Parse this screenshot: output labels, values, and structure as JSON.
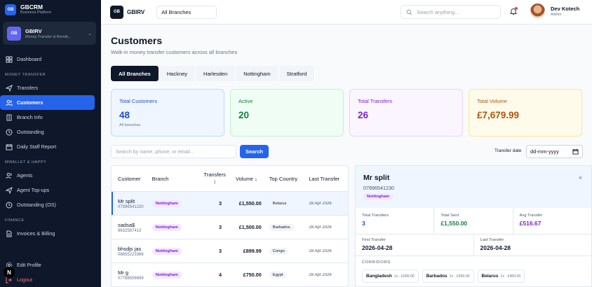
{
  "brand": {
    "logo": "GB",
    "title": "GBCRM",
    "subtitle": "Business Platform"
  },
  "branch_switch": {
    "logo": "GB",
    "name": "GBIRV",
    "description": "Money Transfer & Remitt..."
  },
  "sidebar": {
    "top": [
      {
        "label": "Dashboard",
        "icon": "dashboard-icon"
      }
    ],
    "sections": [
      {
        "title": "MONEY TRANSFER",
        "items": [
          {
            "label": "Transfers",
            "icon": "send-icon"
          },
          {
            "label": "Customers",
            "icon": "users-icon",
            "active": true
          },
          {
            "label": "Branch Info",
            "icon": "building-icon"
          },
          {
            "label": "Outstanding",
            "icon": "clock-icon"
          },
          {
            "label": "Daily Staff Report",
            "icon": "calendar-icon"
          }
        ]
      },
      {
        "title": "MWALLET & HAPPY",
        "items": [
          {
            "label": "Agents",
            "icon": "users-icon"
          },
          {
            "label": "Agent Top-ups",
            "icon": "send-icon"
          },
          {
            "label": "Outstanding (OS)",
            "icon": "clock-icon"
          }
        ]
      },
      {
        "title": "FINANCE",
        "items": [
          {
            "label": "Invoices & Billing",
            "icon": "invoice-icon"
          }
        ]
      }
    ],
    "footer": {
      "edit_profile": "Edit Profile",
      "logout": "Logout"
    },
    "floating_badge": "N"
  },
  "topbar": {
    "logo": "GB",
    "name": "GBIRV",
    "branch_select": "All Branches",
    "search_placeholder": "Search anything...",
    "user": {
      "name": "Dev Kotech",
      "role": "Admin"
    }
  },
  "page": {
    "title": "Customers",
    "subtitle": "Walk-in money transfer customers across all branches",
    "tabs": [
      "All Branches",
      "Hackney",
      "Harlesden",
      "Nottingham",
      "Stratford"
    ],
    "active_tab": 0
  },
  "stats": [
    {
      "label": "Total Customers",
      "value": "48",
      "sub": "All branches",
      "color": "#1d4ed8"
    },
    {
      "label": "Active",
      "value": "20",
      "sub": "",
      "color": "#15803d"
    },
    {
      "label": "Total Transfers",
      "value": "26",
      "sub": "",
      "color": "#7e22ce"
    },
    {
      "label": "Total Volume",
      "value": "£7,679.99",
      "sub": "",
      "color": "#b45309"
    }
  ],
  "filters": {
    "search_placeholder": "Search by name, phone, or email...",
    "search_button": "Search",
    "date_label": "Transfer date",
    "date_placeholder": "dd-mm-yyyy"
  },
  "table": {
    "headers": {
      "customer": "Customer",
      "branch": "Branch",
      "transfers": "Transfers",
      "transfers_sort": "↕",
      "volume": "Volume ↓",
      "country": "Top Country",
      "last": "Last Transfer"
    },
    "rows": [
      {
        "name": "Mr split",
        "phone": "07896541230",
        "branch": "Nottingham",
        "transfers": "3",
        "volume": "£1,550.00",
        "country": "Belarus",
        "last": "28 Apr 2026",
        "selected": true
      },
      {
        "name": "sadsa$",
        "phone": "9632587413",
        "branch": "Nottingham",
        "transfers": "3",
        "volume": "£1,500.00",
        "country": "Barbados",
        "last": "28 Apr 2026"
      },
      {
        "name": "bhsdjs jas",
        "phone": "08855223366",
        "branch": "Nottingham",
        "transfers": "3",
        "volume": "£899.99",
        "country": "Congo",
        "last": "28 Apr 2026"
      },
      {
        "name": "Mr g",
        "phone": "07788556699",
        "branch": "Nottingham",
        "transfers": "4",
        "volume": "£750.00",
        "country": "Egypt",
        "last": "28 Apr 2026"
      }
    ]
  },
  "detail": {
    "name": "Mr split",
    "phone": "07896541230",
    "branch": "Nottingham",
    "close": "×",
    "total_transfers_label": "Total Transfers",
    "total_transfers": "3",
    "total_sent_label": "Total Sent",
    "total_sent": "£1,550.00",
    "avg_transfer_label": "Avg Transfer",
    "avg_transfer": "£516.67",
    "first_transfer_label": "First Transfer",
    "first_transfer": "2026-04-28",
    "last_transfer_label": "Last Transfer",
    "last_transfer": "2026-04-28",
    "corridors_title": "CORRIDORS",
    "corridors": [
      {
        "country": "Bangladesh",
        "meta": "1x · £600.00"
      },
      {
        "country": "Barbados",
        "meta": "1x · £500.00"
      },
      {
        "country": "Belarus",
        "meta": "1x · £450.00"
      }
    ]
  }
}
